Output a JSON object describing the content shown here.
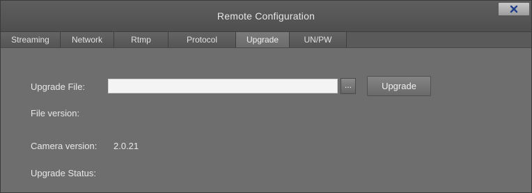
{
  "window": {
    "title": "Remote Configuration",
    "close_label": "×"
  },
  "tabs": [
    {
      "label": "Streaming"
    },
    {
      "label": "Network"
    },
    {
      "label": "Rtmp"
    },
    {
      "label": "Protocol"
    },
    {
      "label": "Upgrade"
    },
    {
      "label": "UN/PW"
    }
  ],
  "active_tab": "Upgrade",
  "upgrade": {
    "file_label": "Upgrade File:",
    "file_value": "",
    "browse_label": "...",
    "upgrade_button_label": "Upgrade",
    "file_version_label": "File version:",
    "file_version_value": "",
    "camera_version_label": "Camera version:",
    "camera_version_value": "2.0.21",
    "status_label": "Upgrade Status:",
    "status_value": ""
  },
  "colors": {
    "background": "#6e6e6e",
    "titlebar": "#555555",
    "close_x": "#1f3f8a"
  }
}
